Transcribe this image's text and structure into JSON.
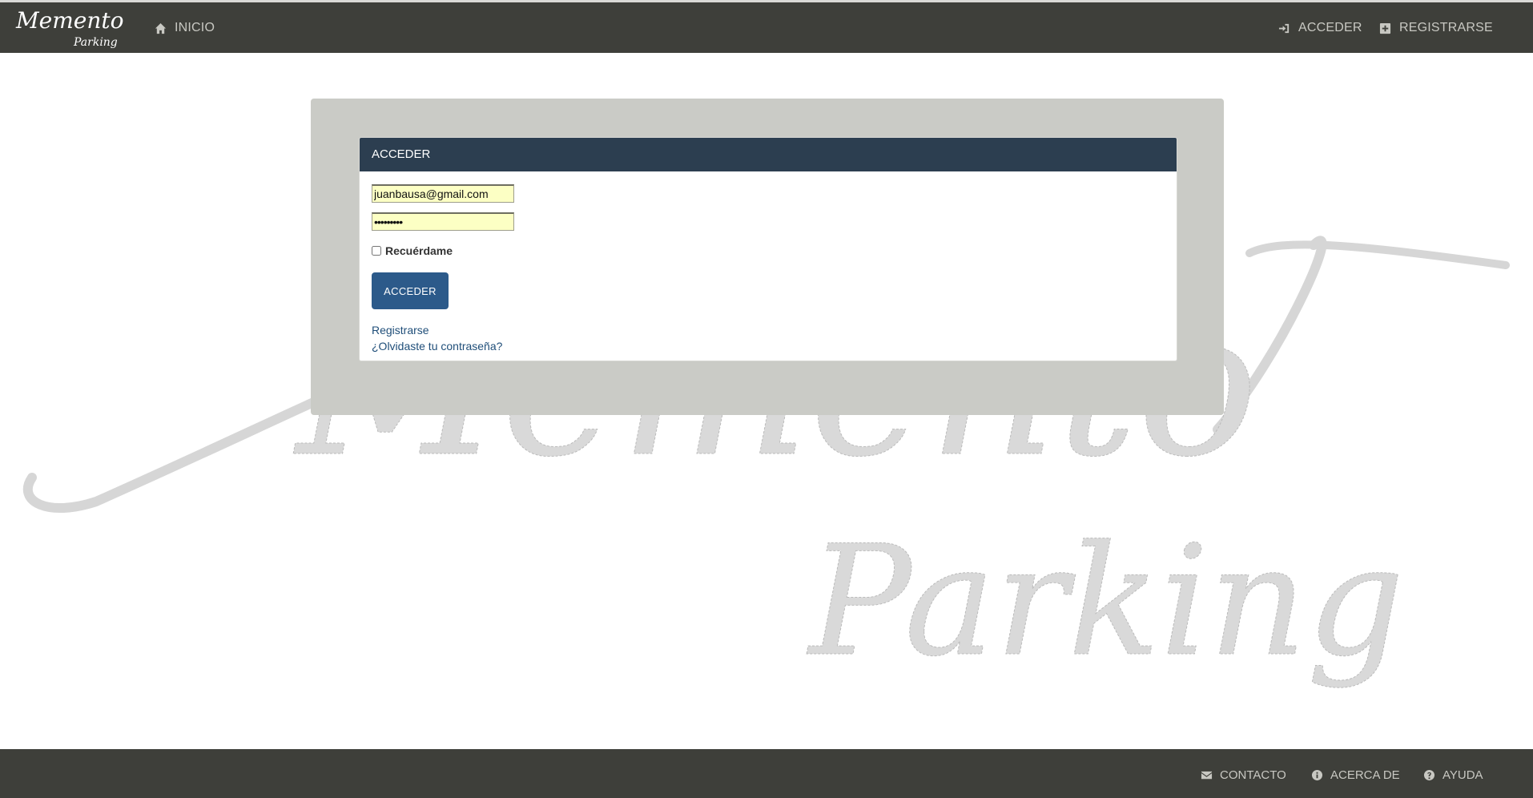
{
  "brand": {
    "line1": "Memento",
    "line2": "Parking"
  },
  "nav": {
    "home": "INICIO",
    "login": "ACCEDER",
    "register": "REGISTRARSE"
  },
  "login_card": {
    "title": "ACCEDER",
    "email_value": "juanbausa@gmail.com",
    "password_value": "•••••••••",
    "remember_label": "Recuérdame",
    "submit_label": "ACCEDER",
    "register_link": "Registrarse",
    "forgot_link": "¿Olvidaste tu contraseña?"
  },
  "background_logo": {
    "line1": "Memento",
    "line2": "Parking"
  },
  "footer": {
    "contact": "CONTACTO",
    "about": "ACERCA DE",
    "help": "AYUDA"
  },
  "colors": {
    "navbar": "#3e3f3a",
    "card_header": "#2c3e50",
    "primary_button": "#2c5a8a",
    "panel": "#cacbc6",
    "autofill_field": "#fcffc4"
  },
  "icons": [
    "home-icon",
    "sign-in-icon",
    "plus-square-icon",
    "envelope-icon",
    "info-circle-icon",
    "question-circle-icon"
  ]
}
